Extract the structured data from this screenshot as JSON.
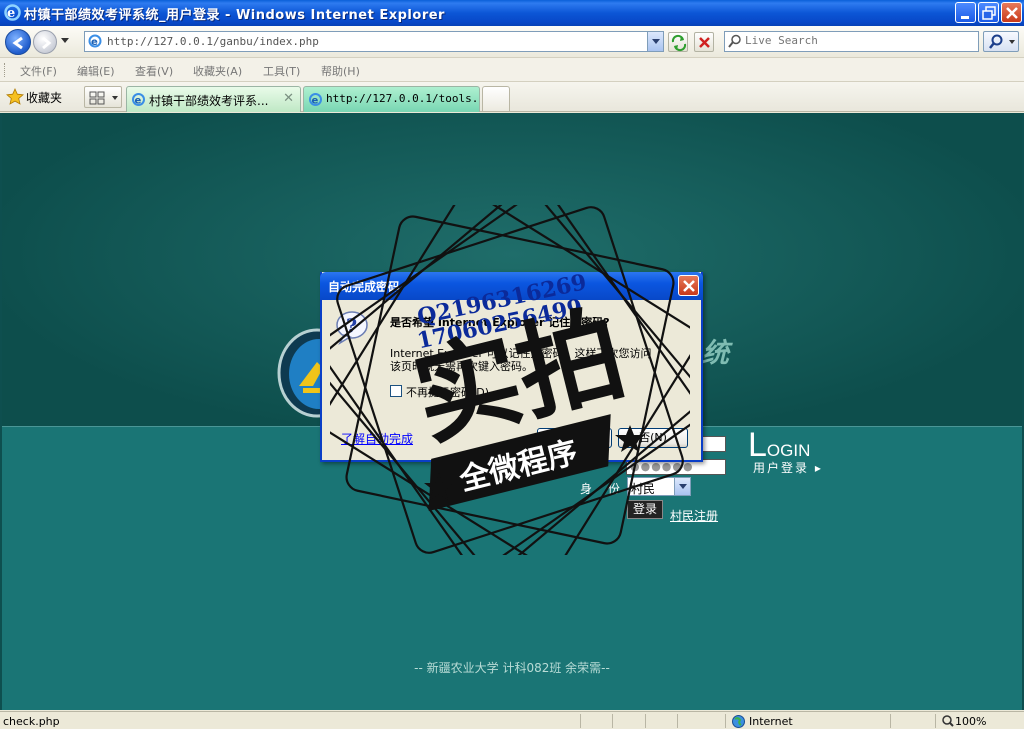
{
  "window": {
    "title": "村镇干部绩效考评系统_用户登录 - Windows Internet Explorer"
  },
  "address_bar": {
    "url": "http://127.0.0.1/ganbu/index.php",
    "search_placeholder": "Live Search"
  },
  "menu": {
    "items": [
      "文件(F)",
      "编辑(E)",
      "查看(V)",
      "收藏夹(A)",
      "工具(T)",
      "帮助(H)"
    ]
  },
  "favorites": {
    "label": "收藏夹"
  },
  "tabs": [
    {
      "label": "村镇干部绩效考评系...",
      "active": true
    },
    {
      "label": "http://127.0.0.1/tools...",
      "active": false
    }
  ],
  "page": {
    "title_tail": "统",
    "login_big_initial": "L",
    "login_big_rest": "OGIN",
    "login_sub": "用户登录 ▸",
    "role_label": "身 份",
    "role_value": "村民",
    "password_value": "●●●●●●",
    "login_button": "登录",
    "register_link": "村民注册",
    "footer": "-- 新疆农业大学 计科082班 余荣需--"
  },
  "dialog": {
    "title": "自动完成密码",
    "question": "是否希望 Internet Explorer 记住此密码?",
    "body_line1": "Internet Explorer 可以记住此密码，这样下次您访问",
    "body_line2": "该页时就无需再次键入密码。",
    "checkbox_label": "不再提示密码(D)",
    "learn_link": "了解自动完成",
    "yes_button": "是(Y)",
    "no_button": "否(N)"
  },
  "watermark": {
    "qq": "Q2196316269",
    "phone": "17060256499",
    "main": "实拍",
    "banner": "全微程序"
  },
  "status_bar": {
    "text": "check.php",
    "zone": "Internet",
    "zoom": "100%"
  },
  "colors": {
    "page_bg": "#1a7575",
    "titlebar": "#0848c8",
    "tab_active": "#bfe8c5"
  }
}
